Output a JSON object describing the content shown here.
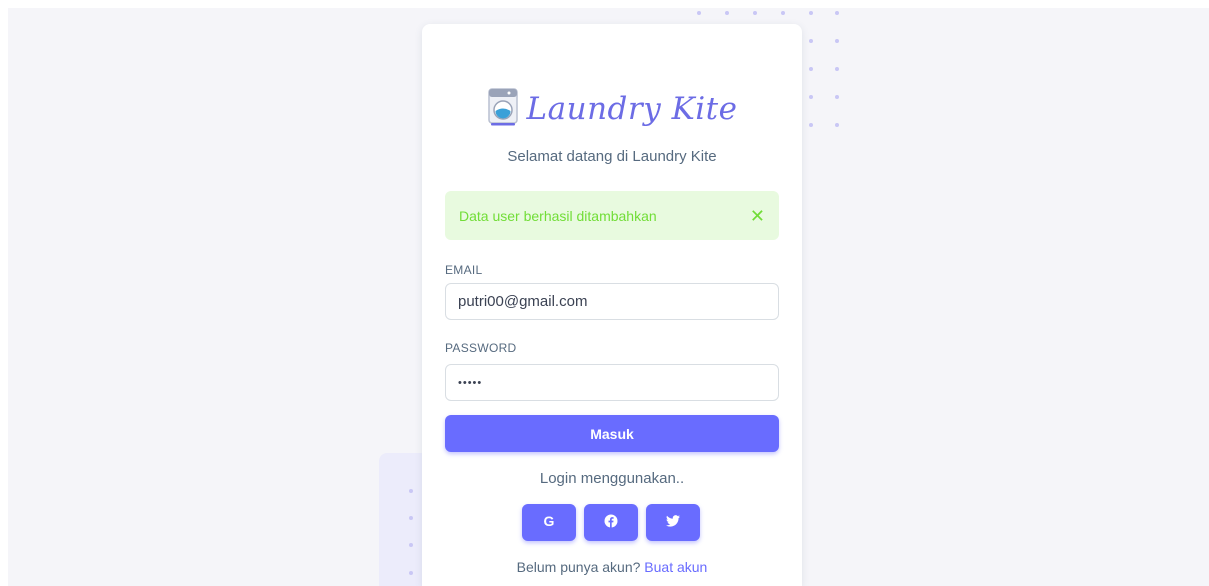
{
  "brand": {
    "name": "Laundry Kite",
    "logo_icon": "washing-machine-icon"
  },
  "welcome_text": "Selamat datang di Laundry Kite",
  "alert": {
    "message": "Data user berhasil ditambahkan",
    "close_icon": "close-icon",
    "color": "#71dd37",
    "background": "#e8fadf"
  },
  "form": {
    "email_label": "EMAIL",
    "email_value": "putri00@gmail.com",
    "password_label": "PASSWORD",
    "password_value": "•••••",
    "submit_label": "Masuk"
  },
  "social": {
    "heading": "Login menggunakan..",
    "buttons": [
      {
        "icon": "google-icon",
        "glyph": "G"
      },
      {
        "icon": "facebook-icon",
        "glyph": "f"
      },
      {
        "icon": "twitter-icon",
        "glyph": "t"
      }
    ]
  },
  "signup": {
    "prompt": "Belum punya akun?",
    "link": "Buat akun"
  },
  "colors": {
    "primary": "#696cff",
    "text": "#566a7f",
    "background": "#f5f5f9"
  }
}
